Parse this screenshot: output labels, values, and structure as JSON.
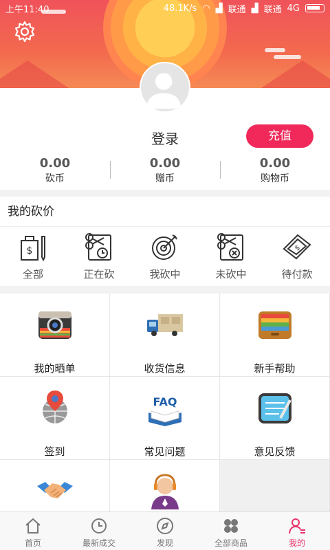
{
  "status_bar": {
    "time": "上午11:40",
    "speed": "48.1K/s",
    "carrier1": "联通",
    "carrier2": "联通",
    "network": "4G"
  },
  "profile": {
    "login_label": "登录",
    "recharge_label": "充值"
  },
  "stats": [
    {
      "value": "0.00",
      "label": "砍币"
    },
    {
      "value": "0.00",
      "label": "赠币"
    },
    {
      "value": "0.00",
      "label": "购物币"
    }
  ],
  "bargain": {
    "title": "我的砍价",
    "items": [
      {
        "label": "全部",
        "icon": "bag-dollar-icon"
      },
      {
        "label": "正在砍",
        "icon": "scissors-clock-icon"
      },
      {
        "label": "我砍中",
        "icon": "target-icon"
      },
      {
        "label": "未砍中",
        "icon": "scissors-x-icon"
      },
      {
        "label": "待付款",
        "icon": "ticket-icon"
      }
    ]
  },
  "grid": [
    {
      "label": "我的晒单",
      "icon": "camera-icon"
    },
    {
      "label": "收货信息",
      "icon": "truck-icon"
    },
    {
      "label": "新手帮助",
      "icon": "drawer-icon"
    },
    {
      "label": "签到",
      "icon": "globe-pin-icon"
    },
    {
      "label": "常见问题",
      "icon": "faq-book-icon"
    },
    {
      "label": "意见反馈",
      "icon": "notepad-icon"
    },
    {
      "label": "",
      "icon": "handshake-icon"
    },
    {
      "label": "",
      "icon": "support-agent-icon"
    }
  ],
  "tabs": [
    {
      "label": "首页",
      "icon": "home-icon"
    },
    {
      "label": "最新成交",
      "icon": "clock-icon"
    },
    {
      "label": "发现",
      "icon": "compass-icon"
    },
    {
      "label": "全部商品",
      "icon": "grid-icon"
    },
    {
      "label": "我的",
      "icon": "user-icon"
    }
  ],
  "colors": {
    "accent": "#f0295a",
    "header": "#f0525a",
    "active_tab": "#e8336b"
  }
}
